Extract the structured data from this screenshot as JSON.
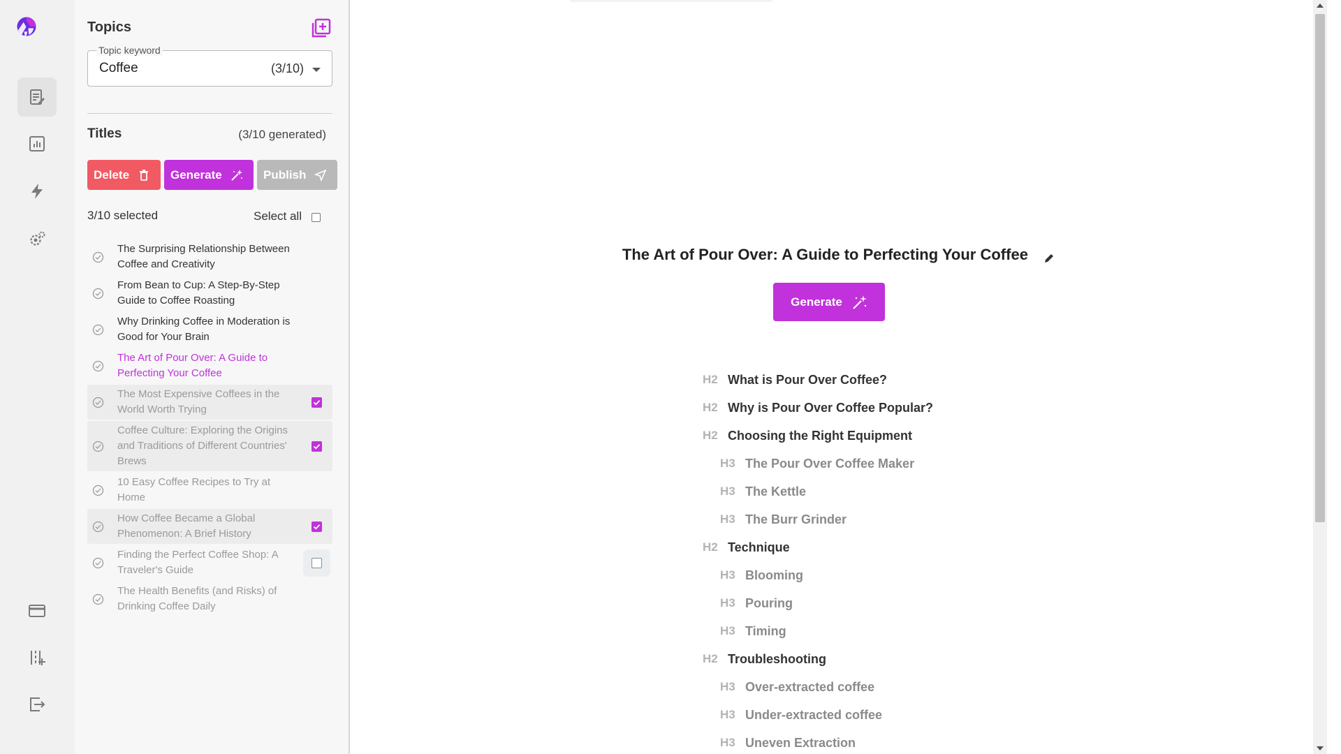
{
  "colors": {
    "accent": "#c131dc",
    "danger": "#f25a63",
    "disabled": "#b9b9b9"
  },
  "sidebar": {
    "logo": "app-logo",
    "items": [
      {
        "icon": "document-edit-icon",
        "active": true
      },
      {
        "icon": "bar-chart-icon",
        "active": false
      },
      {
        "icon": "lightning-icon",
        "active": false
      },
      {
        "icon": "gear-icon",
        "active": false
      }
    ],
    "bottom_items": [
      {
        "icon": "credit-card-icon"
      },
      {
        "icon": "sliders-icon"
      },
      {
        "icon": "logout-icon"
      }
    ]
  },
  "topics": {
    "title": "Topics",
    "keyword_label": "Topic keyword",
    "keyword_value": "Coffee",
    "keyword_count": "(3/10)"
  },
  "titles": {
    "heading": "Titles",
    "generated": "(3/10 generated)",
    "delete_label": "Delete",
    "generate_label": "Generate",
    "publish_label": "Publish",
    "selected_count": "3/10 selected",
    "select_all_label": "Select all",
    "items": [
      {
        "text": "The Surprising Relationship Between Coffee and Creativity",
        "state": "normal"
      },
      {
        "text": "From Bean to Cup: A Step-By-Step Guide to Coffee Roasting",
        "state": "normal"
      },
      {
        "text": "Why Drinking Coffee in Moderation is Good for Your Brain",
        "state": "normal"
      },
      {
        "text": "The Art of Pour Over: A Guide to Perfecting Your Coffee",
        "state": "active"
      },
      {
        "text": "The Most Expensive Coffees in the World Worth Trying",
        "state": "selected"
      },
      {
        "text": "Coffee Culture: Exploring the Origins and Traditions of Different Countries' Brews",
        "state": "selected"
      },
      {
        "text": "10 Easy Coffee Recipes to Try at Home",
        "state": "dim"
      },
      {
        "text": "How Coffee Became a Global Phenomenon: A Brief History",
        "state": "selected"
      },
      {
        "text": "Finding the Perfect Coffee Shop: A Traveler's Guide",
        "state": "hover"
      },
      {
        "text": "The Health Benefits (and Risks) of Drinking Coffee Daily",
        "state": "dim"
      }
    ]
  },
  "article": {
    "title": "The Art of Pour Over: A Guide to Perfecting Your Coffee",
    "generate_label": "Generate",
    "outline": [
      {
        "level": "H2",
        "text": "What is Pour Over Coffee?"
      },
      {
        "level": "H2",
        "text": "Why is Pour Over Coffee Popular?"
      },
      {
        "level": "H2",
        "text": "Choosing the Right Equipment"
      },
      {
        "level": "H3",
        "text": "The Pour Over Coffee Maker"
      },
      {
        "level": "H3",
        "text": "The Kettle"
      },
      {
        "level": "H3",
        "text": "The Burr Grinder"
      },
      {
        "level": "H2",
        "text": "Technique"
      },
      {
        "level": "H3",
        "text": "Blooming"
      },
      {
        "level": "H3",
        "text": "Pouring"
      },
      {
        "level": "H3",
        "text": "Timing"
      },
      {
        "level": "H2",
        "text": "Troubleshooting"
      },
      {
        "level": "H3",
        "text": "Over-extracted coffee"
      },
      {
        "level": "H3",
        "text": "Under-extracted coffee"
      },
      {
        "level": "H3",
        "text": "Uneven Extraction"
      }
    ]
  }
}
